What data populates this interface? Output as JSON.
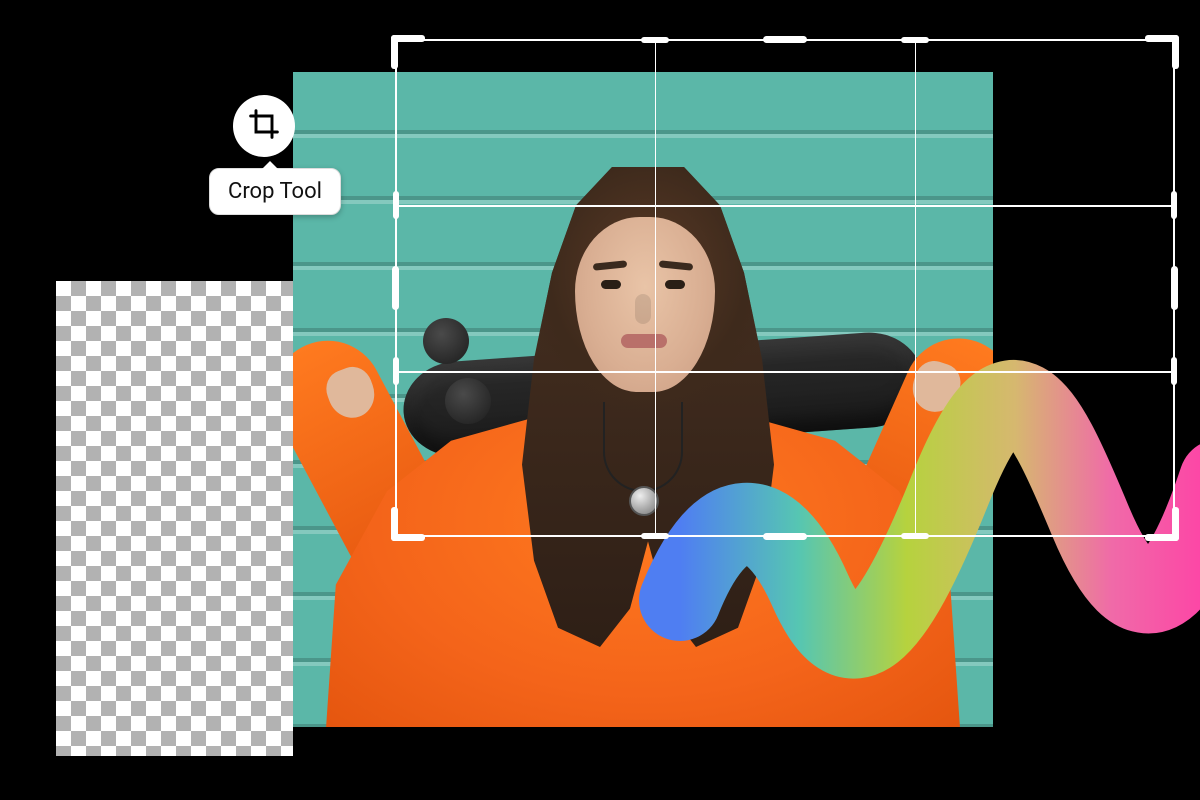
{
  "tooltip": {
    "label": "Crop Tool"
  },
  "tool_icon_name": "crop-icon",
  "stroke_gradient": [
    "#4f7ef2",
    "#56c6b2",
    "#b6d23e",
    "#d6b86f",
    "#f06aa8",
    "#ff3fa5"
  ],
  "colors": {
    "wall": "#5bb7a8",
    "hoodie": "#ff7a1f",
    "checker_light": "#ffffff",
    "checker_dark": "#b2b2b2",
    "crop_frame": "#ffffff"
  }
}
